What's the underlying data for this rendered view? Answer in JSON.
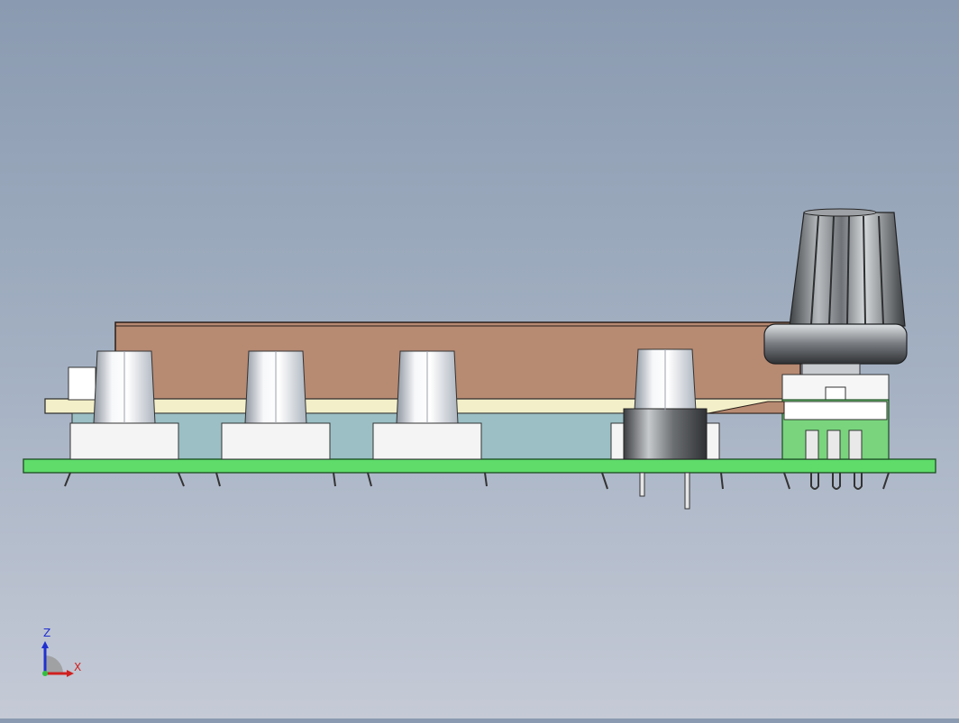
{
  "scene": {
    "background_top": "#8a9ab0",
    "background_bottom": "#c5cad6",
    "colors": {
      "pcb_main": "#5fdc6a",
      "pcb_display": "#b78a72",
      "pcb_top_board": "#f3efc8",
      "switch_body": "#f2f2f2",
      "switch_cap": "#d9dde3",
      "encoder_knob": "#7b7f82",
      "connector_green": "#79d47d"
    },
    "components": [
      "tactile-switch",
      "tactile-switch",
      "tactile-switch",
      "tactile-switch",
      "rotary-encoder-knob"
    ]
  },
  "triad": {
    "z_label": "Z",
    "x_label": "X"
  }
}
